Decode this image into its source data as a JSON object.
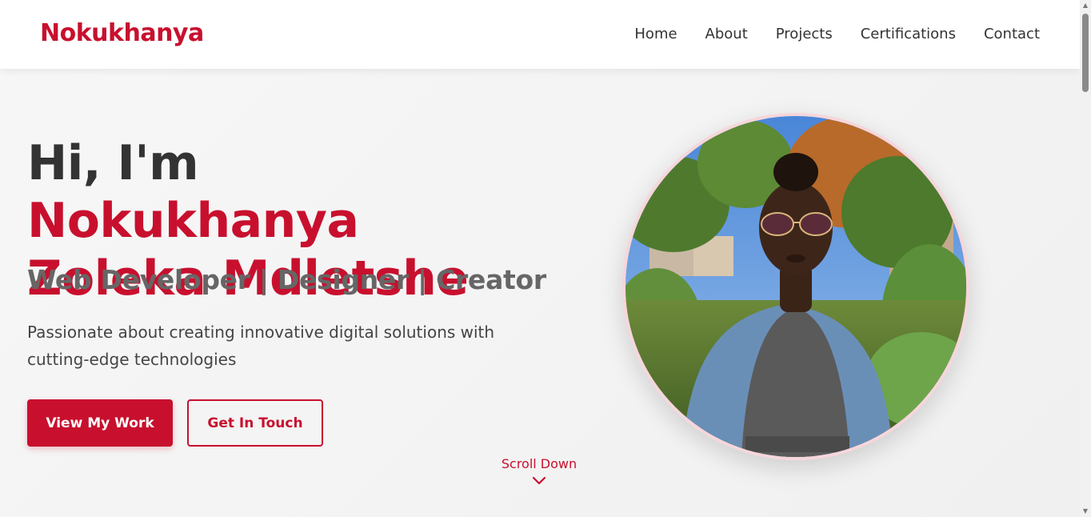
{
  "brand": {
    "name": "Nokukhanya",
    "color": "#c8102e"
  },
  "nav": {
    "items": [
      {
        "label": "Home"
      },
      {
        "label": "About"
      },
      {
        "label": "Projects"
      },
      {
        "label": "Certifications"
      },
      {
        "label": "Contact"
      }
    ]
  },
  "hero": {
    "greeting": "Hi, I'm",
    "name_line1": "Nokukhanya",
    "name_line2": "Zoleka Mdletshe",
    "subtitle": "Web Developer | Designer | Creator",
    "description": "Passionate about creating innovative digital solutions with cutting-edge technologies",
    "primary_button": "View My Work",
    "secondary_button": "Get In Touch",
    "scroll_label": "Scroll Down",
    "scroll_icon": "chevron-down-icon"
  },
  "profile_photo": {
    "icon": "profile-photo"
  },
  "colors": {
    "accent": "#c8102e",
    "text": "#333333",
    "muted": "#666666"
  }
}
